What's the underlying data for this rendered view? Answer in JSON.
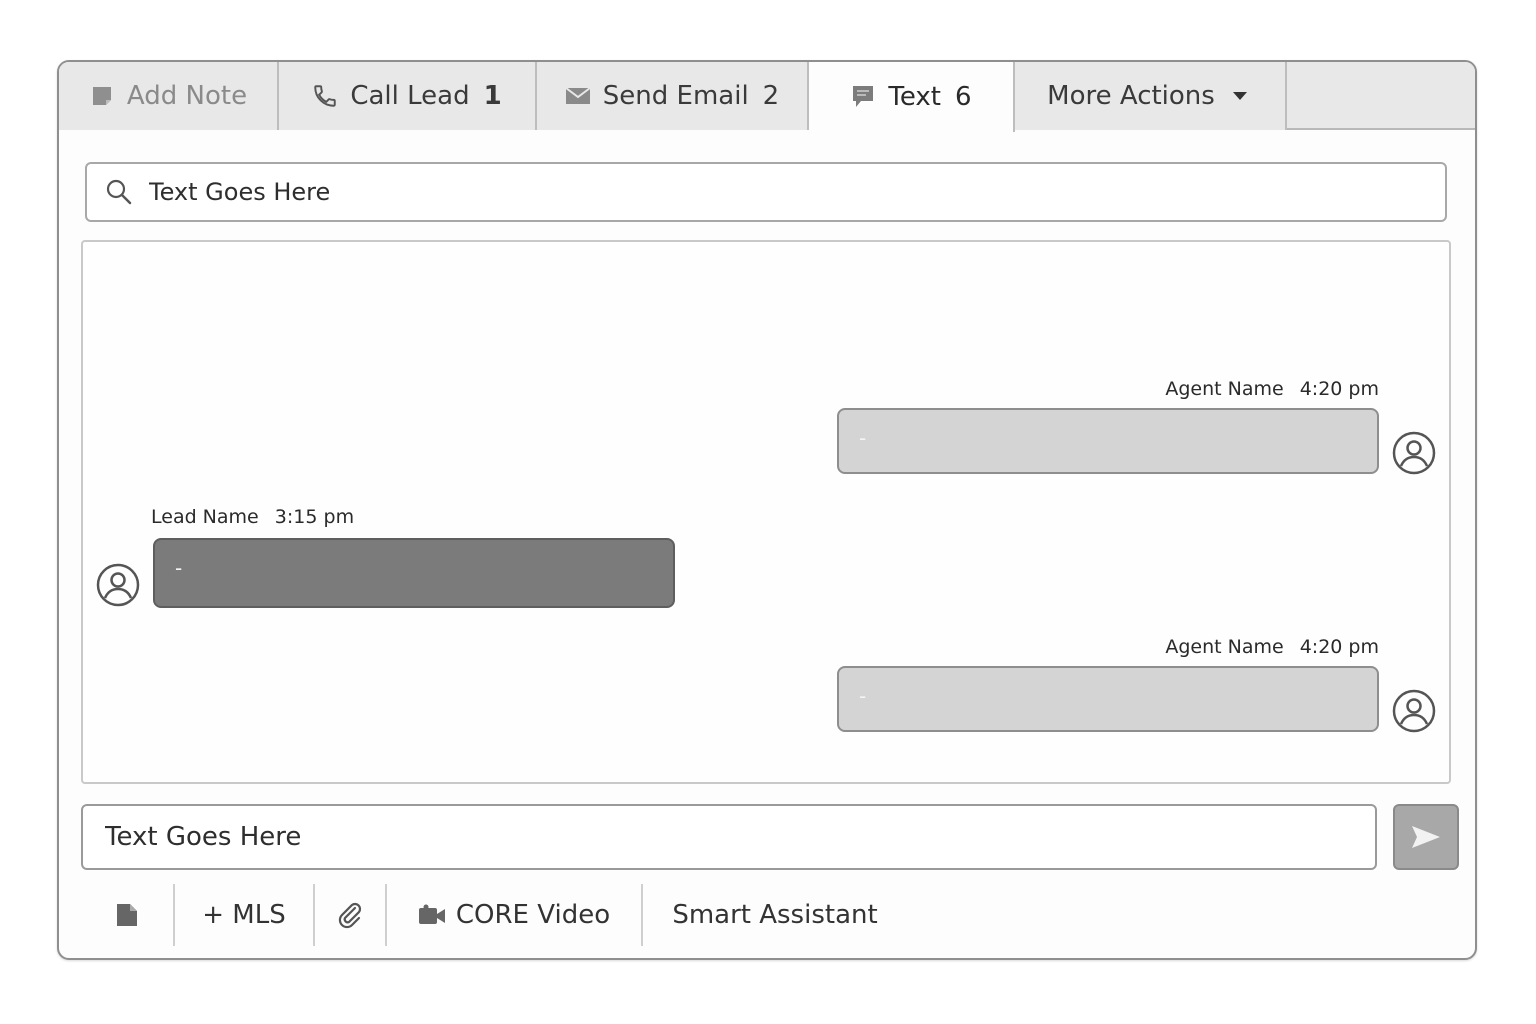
{
  "tabs": [
    {
      "label": "Add Note",
      "count": "",
      "icon": "note-icon"
    },
    {
      "label": "Call Lead",
      "count": "1",
      "icon": "phone-icon"
    },
    {
      "label": "Send Email",
      "count": "2",
      "icon": "email-icon"
    },
    {
      "label": "Text",
      "count": "6",
      "icon": "chat-icon",
      "active": true
    },
    {
      "label": "More Actions",
      "count": "",
      "icon": "caret-down-icon"
    }
  ],
  "search": {
    "placeholder": "Text Goes Here"
  },
  "messages": [
    {
      "sender": "Agent Name",
      "time": "4:20 pm",
      "text": "-",
      "side": "right"
    },
    {
      "sender": "Lead Name",
      "time": "3:15 pm",
      "text": "-",
      "side": "left"
    },
    {
      "sender": "Agent Name",
      "time": "4:20 pm",
      "text": "-",
      "side": "right"
    }
  ],
  "composer": {
    "placeholder": "Text Goes Here"
  },
  "toolbar": {
    "mls_label": "+ MLS",
    "video_label": "CORE Video",
    "assistant_label": "Smart Assistant"
  },
  "colors": {
    "agent_bubble": "#d4d4d4",
    "lead_bubble": "#7b7b7b",
    "send_button": "#a8a8a8"
  }
}
